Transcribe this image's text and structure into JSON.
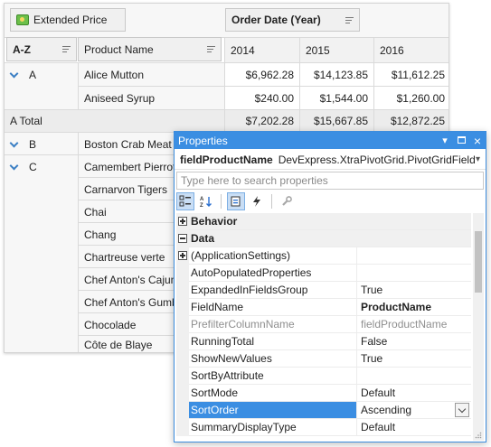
{
  "pivot": {
    "data_field": "Extended Price",
    "column_field": "Order Date (Year)",
    "row_field": "A-Z",
    "row_field2": "Product Name",
    "years": [
      "2014",
      "2015",
      "2016"
    ],
    "rows": [
      {
        "group": "A",
        "product": "Alice Mutton",
        "v2014": "$6,962.28",
        "v2015": "$14,123.85",
        "v2016": "$11,612.25"
      },
      {
        "group": "",
        "product": "Aniseed Syrup",
        "v2014": "$240.00",
        "v2015": "$1,544.00",
        "v2016": "$1,260.00"
      }
    ],
    "total": {
      "label": "A Total",
      "v2014": "$7,202.28",
      "v2015": "$15,667.85",
      "v2016": "$12,872.25"
    },
    "group_b": "B",
    "group_b_products": [
      "Boston Crab Meat"
    ],
    "group_c": "C",
    "group_c_products": [
      "Camembert Pierrot",
      "Carnarvon Tigers",
      "Chai",
      "Chang",
      "Chartreuse verte",
      "Chef Anton's Cajun S",
      "Chef Anton's Gumbo",
      "Chocolade",
      "Côte de Blaye"
    ]
  },
  "props": {
    "title": "Properties",
    "object_name": "fieldProductName",
    "object_type": "DevExpress.XtraPivotGrid.PivotGridField",
    "search_placeholder": "Type here to search properties",
    "rows": [
      {
        "kind": "cat",
        "name": "Behavior",
        "expander": "plus"
      },
      {
        "kind": "cat",
        "name": "Data",
        "expander": "minus"
      },
      {
        "kind": "item",
        "name": "(ApplicationSettings)",
        "value": "",
        "expander": "plus"
      },
      {
        "kind": "item",
        "name": "AutoPopulatedProperties",
        "value": ""
      },
      {
        "kind": "item",
        "name": "ExpandedInFieldsGroup",
        "value": "True"
      },
      {
        "kind": "item",
        "name": "FieldName",
        "value": "ProductName",
        "bold": true
      },
      {
        "kind": "item",
        "name": "PrefilterColumnName",
        "value": "fieldProductName",
        "gray": true
      },
      {
        "kind": "item",
        "name": "RunningTotal",
        "value": "False"
      },
      {
        "kind": "item",
        "name": "ShowNewValues",
        "value": "True"
      },
      {
        "kind": "item",
        "name": "SortByAttribute",
        "value": ""
      },
      {
        "kind": "item",
        "name": "SortMode",
        "value": "Default"
      },
      {
        "kind": "item",
        "name": "SortOrder",
        "value": "Ascending",
        "selected": true
      },
      {
        "kind": "item",
        "name": "SummaryDisplayType",
        "value": "Default"
      }
    ]
  },
  "colors": {
    "accent": "#3b8ee2",
    "chevron": "#3b7fc4"
  }
}
